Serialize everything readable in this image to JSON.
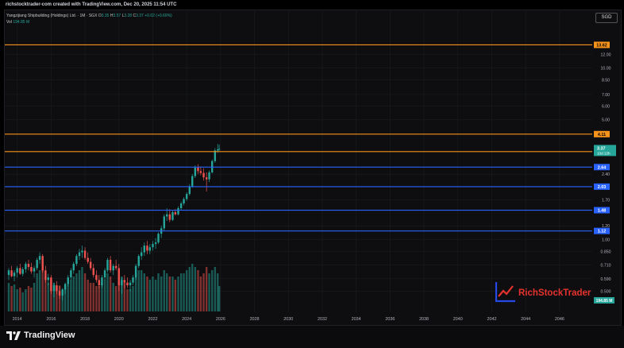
{
  "header": {
    "created_text": "richstocktrader-com created with TradingView.com, Dec 20, 2025 11:54 UTC"
  },
  "legend": {
    "symbol_name": "Yangzijiang Shipbuilding (Holdings) Ltd. · 1M · SGX",
    "o_label": "O",
    "o_value": "3.35",
    "h_label": "H",
    "h_value": "3.57",
    "l_label": "L",
    "l_value": "3.28",
    "c_label": "C",
    "c_value": "3.37",
    "change": "+0.02 (+0.60%)",
    "vol_label": "Vol",
    "vol_value": "194.85 M"
  },
  "currency": "SGD",
  "colors": {
    "up": "#26a69a",
    "down": "#ef5350",
    "resistance_orange": "#f7931a",
    "support_blue": "#2962ff",
    "background": "#0e0e10",
    "brand_blue": "#2549e6",
    "brand_red": "#e8322e"
  },
  "chart_data": {
    "type": "candlestick",
    "scale": "log",
    "xlabel": "",
    "ylabel": "",
    "x_range": [
      2013.5,
      2047.5
    ],
    "y_range": [
      0.38,
      16.5
    ],
    "x_ticks": [
      "2014",
      "2016",
      "2018",
      "2020",
      "2022",
      "2024",
      "2026",
      "2028",
      "2030",
      "2032",
      "2034",
      "2036",
      "2038",
      "2040",
      "2042",
      "2044",
      "2046"
    ],
    "y_ticks": [
      {
        "value": 12.0,
        "label": "12.00"
      },
      {
        "value": 10.0,
        "label": "10.00"
      },
      {
        "value": 8.5,
        "label": "8.50"
      },
      {
        "value": 7.0,
        "label": "7.00"
      },
      {
        "value": 6.0,
        "label": "6.00"
      },
      {
        "value": 5.0,
        "label": "5.00"
      },
      {
        "value": 2.4,
        "label": "2.40"
      },
      {
        "value": 1.7,
        "label": "1.70"
      },
      {
        "value": 1.2,
        "label": "1.20"
      },
      {
        "value": 1.0,
        "label": "1.00"
      },
      {
        "value": 0.85,
        "label": "0.850"
      },
      {
        "value": 0.71,
        "label": "0.710"
      },
      {
        "value": 0.59,
        "label": "0.590"
      },
      {
        "value": 0.5,
        "label": "0.500"
      }
    ],
    "horizontal_levels": [
      {
        "value": 13.62,
        "label": "13.62",
        "kind": "resistance"
      },
      {
        "value": 4.11,
        "label": "4.11",
        "kind": "resistance"
      },
      {
        "value": 3.25,
        "label": "3.25",
        "kind": "resistance"
      },
      {
        "value": 2.64,
        "label": "2.64",
        "kind": "support"
      },
      {
        "value": 2.03,
        "label": "2.03",
        "kind": "support"
      },
      {
        "value": 1.48,
        "label": "1.48",
        "kind": "support"
      },
      {
        "value": 1.12,
        "label": "1.12",
        "kind": "support"
      }
    ],
    "last_price": {
      "value": 3.37,
      "label": "3.37",
      "countdown": "10d 22h"
    },
    "volume_label": "194.85 M",
    "candles": [
      [
        2013.5,
        0.62,
        0.68,
        0.58,
        0.66,
        0.9
      ],
      [
        2013.67,
        0.66,
        0.7,
        0.6,
        0.61,
        0.8
      ],
      [
        2013.83,
        0.61,
        0.66,
        0.57,
        0.64,
        0.85
      ],
      [
        2014.0,
        0.64,
        0.7,
        0.6,
        0.68,
        0.7
      ],
      [
        2014.17,
        0.68,
        0.72,
        0.62,
        0.63,
        0.75
      ],
      [
        2014.33,
        0.63,
        0.69,
        0.61,
        0.67,
        0.6
      ],
      [
        2014.5,
        0.67,
        0.74,
        0.64,
        0.72,
        0.7
      ],
      [
        2014.67,
        0.72,
        0.76,
        0.66,
        0.69,
        0.8
      ],
      [
        2014.83,
        0.69,
        0.73,
        0.63,
        0.65,
        0.75
      ],
      [
        2015.0,
        0.65,
        0.7,
        0.6,
        0.68,
        0.9
      ],
      [
        2015.17,
        0.68,
        0.78,
        0.66,
        0.76,
        1.2
      ],
      [
        2015.33,
        0.76,
        0.84,
        0.72,
        0.8,
        1.3
      ],
      [
        2015.5,
        0.8,
        0.82,
        0.64,
        0.66,
        1.4
      ],
      [
        2015.67,
        0.66,
        0.7,
        0.56,
        0.58,
        1.1
      ],
      [
        2015.83,
        0.58,
        0.63,
        0.54,
        0.6,
        0.9
      ],
      [
        2016.0,
        0.6,
        0.62,
        0.48,
        0.5,
        1.0
      ],
      [
        2016.17,
        0.5,
        0.56,
        0.46,
        0.54,
        0.9
      ],
      [
        2016.33,
        0.54,
        0.57,
        0.48,
        0.5,
        0.8
      ],
      [
        2016.5,
        0.5,
        0.54,
        0.45,
        0.47,
        0.8
      ],
      [
        2016.67,
        0.47,
        0.52,
        0.44,
        0.51,
        0.7
      ],
      [
        2016.83,
        0.51,
        0.56,
        0.48,
        0.55,
        0.8
      ],
      [
        2017.0,
        0.55,
        0.62,
        0.53,
        0.6,
        0.9
      ],
      [
        2017.17,
        0.6,
        0.68,
        0.58,
        0.66,
        1.0
      ],
      [
        2017.33,
        0.66,
        0.74,
        0.63,
        0.72,
        1.1
      ],
      [
        2017.5,
        0.72,
        0.82,
        0.7,
        0.8,
        1.2
      ],
      [
        2017.67,
        0.8,
        0.88,
        0.76,
        0.84,
        1.3
      ],
      [
        2017.83,
        0.84,
        0.92,
        0.78,
        0.86,
        1.4
      ],
      [
        2018.0,
        0.86,
        0.9,
        0.76,
        0.78,
        1.2
      ],
      [
        2018.17,
        0.78,
        0.84,
        0.72,
        0.74,
        1.0
      ],
      [
        2018.33,
        0.74,
        0.78,
        0.66,
        0.68,
        0.9
      ],
      [
        2018.5,
        0.68,
        0.72,
        0.6,
        0.62,
        0.9
      ],
      [
        2018.67,
        0.62,
        0.66,
        0.56,
        0.58,
        0.8
      ],
      [
        2018.83,
        0.58,
        0.62,
        0.52,
        0.54,
        0.8
      ],
      [
        2019.0,
        0.54,
        0.62,
        0.52,
        0.6,
        0.9
      ],
      [
        2019.17,
        0.6,
        0.68,
        0.58,
        0.66,
        1.0
      ],
      [
        2019.33,
        0.66,
        0.78,
        0.64,
        0.76,
        1.2
      ],
      [
        2019.5,
        0.76,
        0.8,
        0.64,
        0.66,
        1.1
      ],
      [
        2019.67,
        0.66,
        0.72,
        0.62,
        0.7,
        0.9
      ],
      [
        2019.83,
        0.7,
        0.76,
        0.66,
        0.68,
        0.8
      ],
      [
        2020.0,
        0.68,
        0.72,
        0.5,
        0.54,
        1.3
      ],
      [
        2020.17,
        0.54,
        0.6,
        0.48,
        0.58,
        1.1
      ],
      [
        2020.33,
        0.58,
        0.62,
        0.52,
        0.56,
        0.9
      ],
      [
        2020.5,
        0.56,
        0.6,
        0.52,
        0.54,
        0.7
      ],
      [
        2020.67,
        0.54,
        0.58,
        0.5,
        0.56,
        0.7
      ],
      [
        2020.83,
        0.56,
        0.62,
        0.54,
        0.6,
        0.8
      ],
      [
        2021.0,
        0.6,
        0.72,
        0.58,
        0.7,
        1.2
      ],
      [
        2021.17,
        0.7,
        0.82,
        0.68,
        0.8,
        1.3
      ],
      [
        2021.33,
        0.8,
        0.9,
        0.76,
        0.84,
        1.3
      ],
      [
        2021.5,
        0.84,
        0.96,
        0.8,
        0.92,
        1.2
      ],
      [
        2021.67,
        0.92,
        0.98,
        0.82,
        0.86,
        1.1
      ],
      [
        2021.83,
        0.86,
        0.94,
        0.82,
        0.9,
        1.0
      ],
      [
        2022.0,
        0.9,
        0.98,
        0.86,
        0.94,
        1.1
      ],
      [
        2022.17,
        0.94,
        1.02,
        0.88,
        0.96,
        1.0
      ],
      [
        2022.33,
        0.96,
        1.1,
        0.94,
        1.08,
        1.2
      ],
      [
        2022.5,
        1.08,
        1.2,
        1.02,
        1.16,
        1.1
      ],
      [
        2022.67,
        1.16,
        1.4,
        1.12,
        1.36,
        1.3
      ],
      [
        2022.83,
        1.36,
        1.52,
        1.28,
        1.4,
        1.2
      ],
      [
        2023.0,
        1.4,
        1.5,
        1.26,
        1.3,
        1.1
      ],
      [
        2023.17,
        1.3,
        1.48,
        1.28,
        1.44,
        1.1
      ],
      [
        2023.33,
        1.44,
        1.5,
        1.38,
        1.4,
        1.0
      ],
      [
        2023.5,
        1.4,
        1.56,
        1.38,
        1.52,
        1.1
      ],
      [
        2023.67,
        1.52,
        1.66,
        1.48,
        1.62,
        1.2
      ],
      [
        2023.83,
        1.62,
        1.76,
        1.58,
        1.72,
        1.2
      ],
      [
        2024.0,
        1.72,
        1.88,
        1.68,
        1.84,
        1.3
      ],
      [
        2024.17,
        1.84,
        2.1,
        1.8,
        2.04,
        1.4
      ],
      [
        2024.33,
        2.04,
        2.4,
        2.0,
        2.34,
        1.5
      ],
      [
        2024.5,
        2.34,
        2.7,
        2.28,
        2.62,
        1.4
      ],
      [
        2024.67,
        2.62,
        2.74,
        2.4,
        2.5,
        1.3
      ],
      [
        2024.83,
        2.5,
        2.66,
        2.36,
        2.44,
        1.1
      ],
      [
        2025.0,
        2.44,
        2.6,
        2.2,
        2.3,
        1.2
      ],
      [
        2025.17,
        2.3,
        2.46,
        1.9,
        2.24,
        1.4
      ],
      [
        2025.33,
        2.24,
        2.52,
        2.16,
        2.46,
        1.2
      ],
      [
        2025.5,
        2.46,
        2.92,
        2.42,
        2.86,
        1.3
      ],
      [
        2025.67,
        2.86,
        3.4,
        2.8,
        3.3,
        1.4
      ],
      [
        2025.83,
        3.3,
        3.6,
        3.2,
        3.35,
        1.2
      ],
      [
        2025.92,
        3.35,
        3.57,
        3.28,
        3.37,
        0.8
      ]
    ]
  },
  "watermark": {
    "brand_text": "RichStockTrader"
  },
  "footer": {
    "brand": "TradingView"
  }
}
